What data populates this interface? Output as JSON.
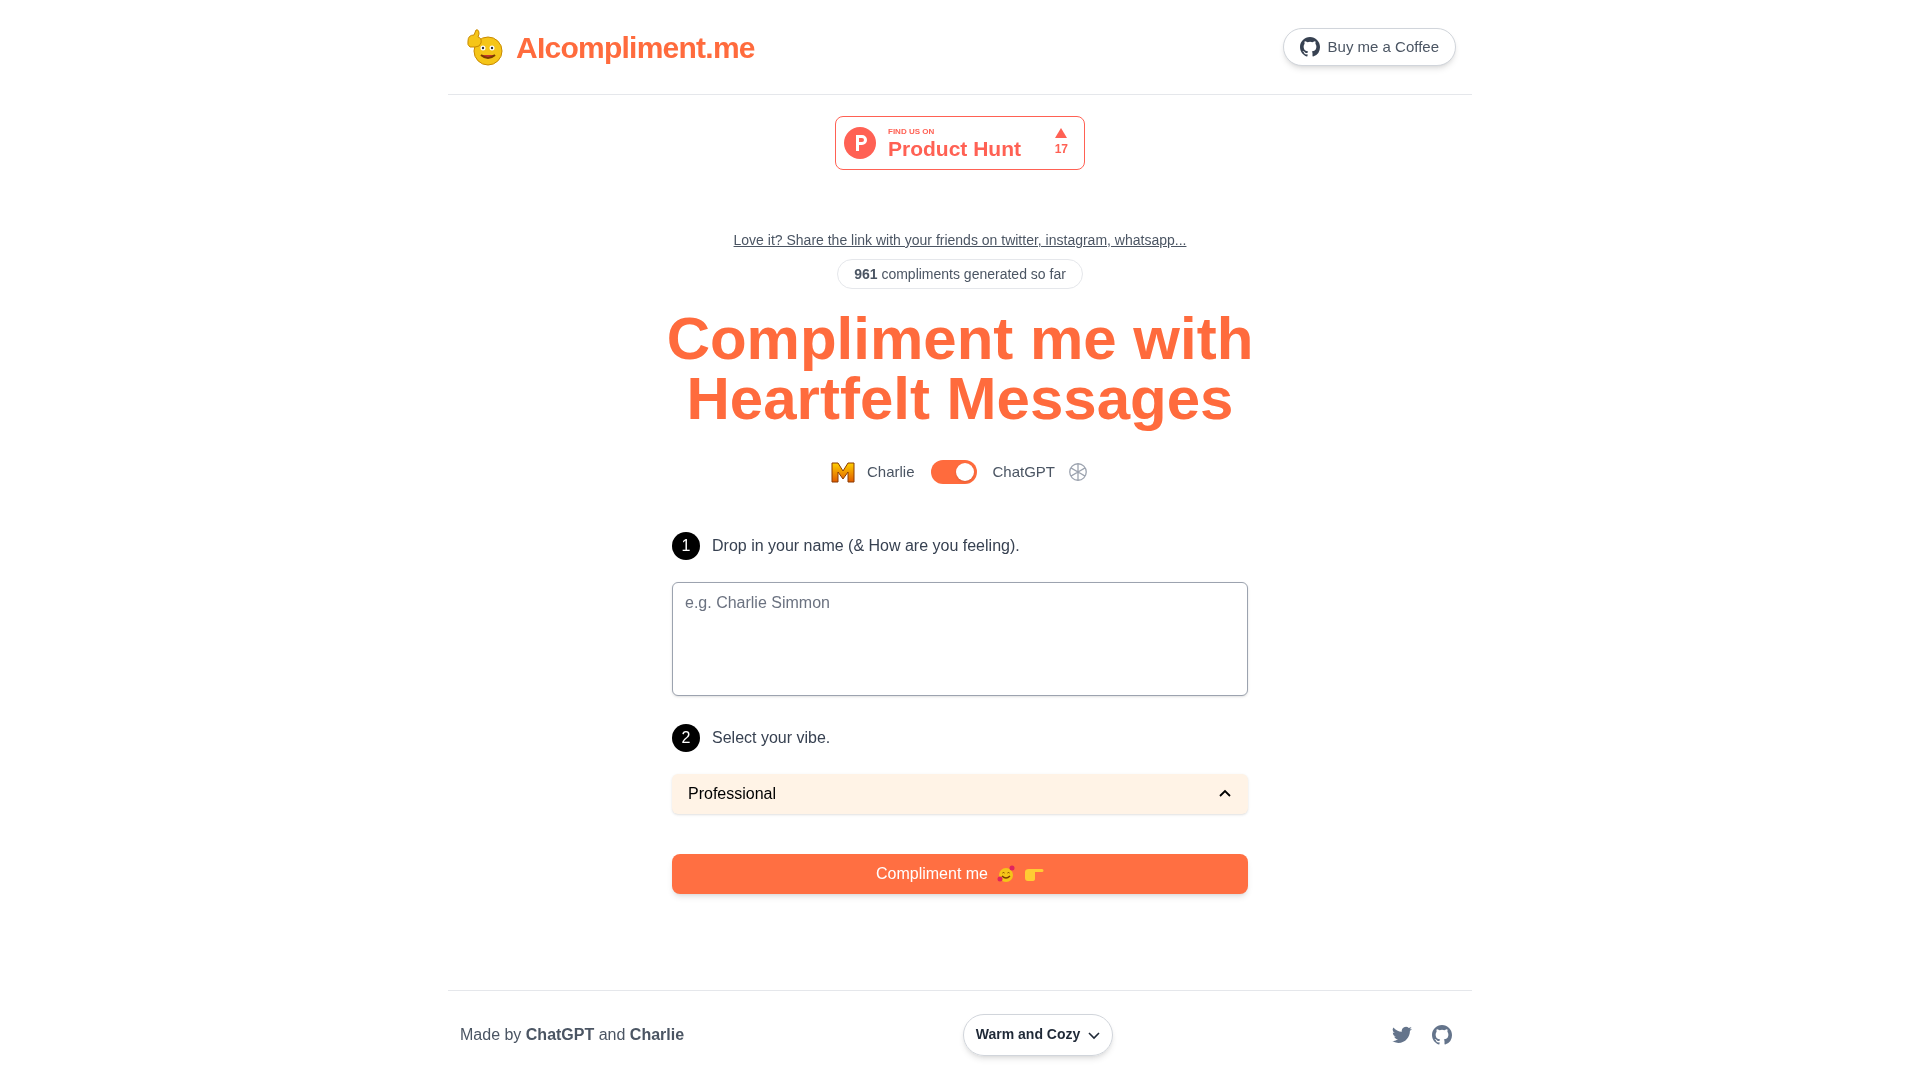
{
  "header": {
    "brand": "AIcompliment.me",
    "button": "Buy me a Coffee"
  },
  "badge": {
    "kicker": "FIND US ON",
    "name": "Product Hunt",
    "count": "17"
  },
  "share_link": "Love it? Share the link with your friends on twitter, instagram, whatsapp...",
  "counter": "**961** compliments generated so far",
  "heading": [
    "Compliment me with",
    "Heartfelt Messages"
  ],
  "model_toggle": {
    "left": "Charlie",
    "right": "ChatGPT",
    "on": true
  },
  "steps": [
    {
      "number": "1",
      "label": "Drop in your name (& How are you feeling)."
    },
    {
      "number": "2",
      "label": "Select your vibe."
    }
  ],
  "name_field": {
    "placeholder": "e.g. Charlie Simmon"
  },
  "vibe_select": {
    "value": "Professional",
    "expanded": true
  },
  "submit": "Compliment me",
  "footer": {
    "credit": "Made by **ChatGPT** and **Charlie**",
    "theme": "Warm and Cozy"
  }
}
